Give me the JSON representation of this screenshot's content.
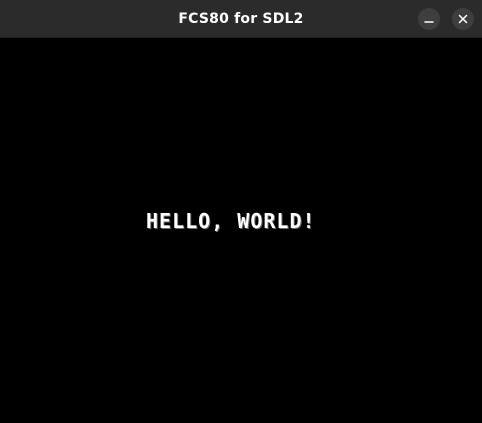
{
  "window": {
    "title": "FCS80 for SDL2",
    "buttons": [
      {
        "name": "minimize",
        "icon": "minimize-icon"
      },
      {
        "name": "close",
        "icon": "close-icon"
      }
    ]
  },
  "screen": {
    "text": "HELLO, WORLD!"
  },
  "colors": {
    "titlebar": "#2b2b2b",
    "button_bg": "#3e3e3e",
    "screen_bg": "#000000",
    "text": "#ffffff"
  }
}
